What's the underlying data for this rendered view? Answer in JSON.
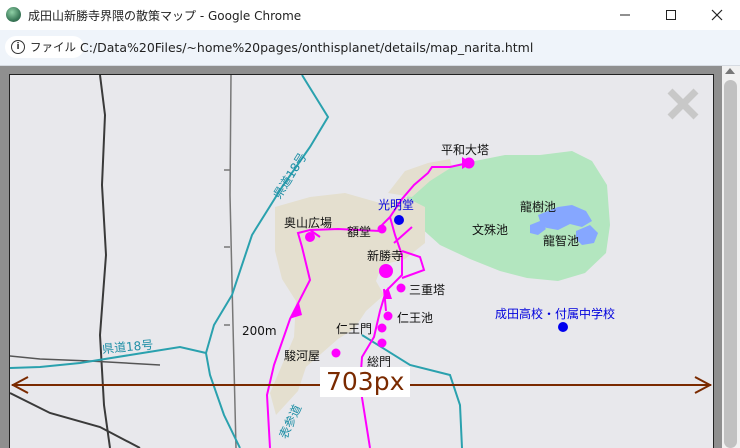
{
  "window": {
    "title": "成田山新勝寺界隈の散策マップ - Google Chrome",
    "minimize_icon": "minimize-icon",
    "maximize_icon": "maximize-icon",
    "close_icon": "close-icon"
  },
  "address": {
    "chip_label": "ファイル",
    "chip_icon": "info-icon",
    "url": "C:/Data%20Files/~home%20pages/onthisplanet/details/map_narita.html"
  },
  "map": {
    "labels": {
      "peace_pagoda": "平和大塔",
      "komyodo": "光明堂",
      "okuyama": "奥山広場",
      "gakudo": "額堂",
      "shinshoji": "新勝寺",
      "sanju_no_to": "三重塔",
      "nioike": "仁王池",
      "niomon": "仁王門",
      "surugaya": "駿河屋",
      "somon": "総門",
      "ryujuike": "龍樹池",
      "monjuike": "文殊池",
      "ryuchiike": "龍智池",
      "narita_hs": "成田高校・付属中学校",
      "scale": "200m",
      "kendo18_top": "県道18号",
      "kendo18_left": "県道18号",
      "omotesando": "表参道"
    },
    "close_icon": "close-x-icon",
    "measure_label": "703px",
    "colors": {
      "route": "#ff00ff",
      "pond": "#86a7ff",
      "park": "#b3e6bf",
      "temple_area": "#e4dfcf",
      "road_label": "#1f8fa6",
      "measure": "#7a2a00",
      "school": "#0000dd"
    }
  }
}
